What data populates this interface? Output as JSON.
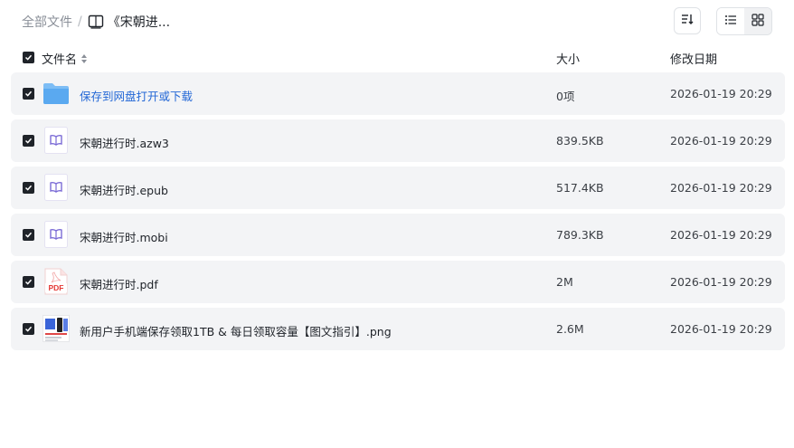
{
  "breadcrumb": {
    "root": "全部文件",
    "separator": "/",
    "current": "《宋朝进..."
  },
  "toolbar": {
    "sort_icon": "sort-icon",
    "list_view_icon": "list-view-icon",
    "grid_view_icon": "grid-view-icon"
  },
  "columns": {
    "name": "文件名",
    "size": "大小",
    "modified": "修改日期"
  },
  "files": [
    {
      "name": "保存到网盘打开或下载",
      "size": "0项",
      "date": "2026-01-19 20:29",
      "icon": "folder-icon",
      "link": true
    },
    {
      "name": "宋朝进行时.azw3",
      "size": "839.5KB",
      "date": "2026-01-19 20:29",
      "icon": "ebook-icon"
    },
    {
      "name": "宋朝进行时.epub",
      "size": "517.4KB",
      "date": "2026-01-19 20:29",
      "icon": "ebook-icon"
    },
    {
      "name": "宋朝进行时.mobi",
      "size": "789.3KB",
      "date": "2026-01-19 20:29",
      "icon": "ebook-icon"
    },
    {
      "name": "宋朝进行时.pdf",
      "size": "2M",
      "date": "2026-01-19 20:29",
      "icon": "pdf-icon"
    },
    {
      "name": "新用户手机端保存领取1TB & 每日领取容量【图文指引】.png",
      "size": "2.6M",
      "date": "2026-01-19 20:29",
      "icon": "image-thumbnail"
    }
  ],
  "colors": {
    "accent": "#2468d6",
    "row_bg": "#f3f4f6",
    "ebook_icon": "#7b6bd6",
    "pdf_red": "#e53935",
    "folder_blue": "#5aa9f0"
  }
}
